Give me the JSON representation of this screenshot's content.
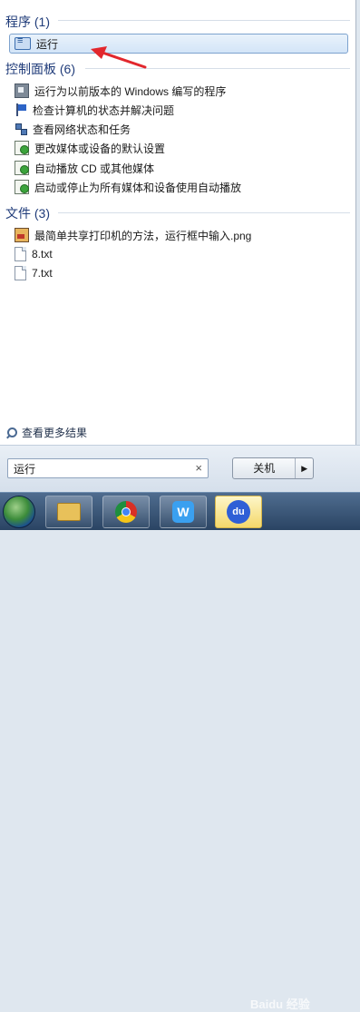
{
  "sections": {
    "programs": {
      "header": "程序 (1)",
      "items": [
        {
          "label": "运行",
          "icon": "run-icon",
          "selected": true
        }
      ]
    },
    "control_panel": {
      "header": "控制面板 (6)",
      "items": [
        {
          "label": "运行为以前版本的 Windows 编写的程序",
          "icon": "compatibility-icon"
        },
        {
          "label": "检查计算机的状态并解决问题",
          "icon": "action-center-flag-icon"
        },
        {
          "label": "查看网络状态和任务",
          "icon": "network-icon"
        },
        {
          "label": "更改媒体或设备的默认设置",
          "icon": "autoplay-icon"
        },
        {
          "label": "自动播放 CD 或其他媒体",
          "icon": "autoplay-icon"
        },
        {
          "label": "启动或停止为所有媒体和设备使用自动播放",
          "icon": "autoplay-icon"
        }
      ]
    },
    "files": {
      "header": "文件 (3)",
      "items": [
        {
          "label": "最简单共享打印机的方法，运行框中输入.png",
          "icon": "png-file-icon"
        },
        {
          "label": "8.txt",
          "icon": "text-file-icon"
        },
        {
          "label": "7.txt",
          "icon": "text-file-icon"
        }
      ]
    }
  },
  "see_more": {
    "label": "查看更多结果",
    "icon": "search-icon"
  },
  "search": {
    "value": "运行",
    "clear_glyph": "×"
  },
  "shutdown": {
    "label": "关机",
    "arrow_glyph": "▶"
  },
  "taskbar": {
    "items": [
      {
        "name": "start-button"
      },
      {
        "name": "explorer-icon"
      },
      {
        "name": "chrome-icon"
      },
      {
        "name": "wps-icon",
        "text": "W"
      },
      {
        "name": "baidu-icon",
        "text": "du"
      }
    ]
  },
  "watermark": "Baidu 经验",
  "colors": {
    "header_blue": "#1f3b79",
    "annotation_red": "#e2272d",
    "selection_border": "#7da2ce"
  }
}
